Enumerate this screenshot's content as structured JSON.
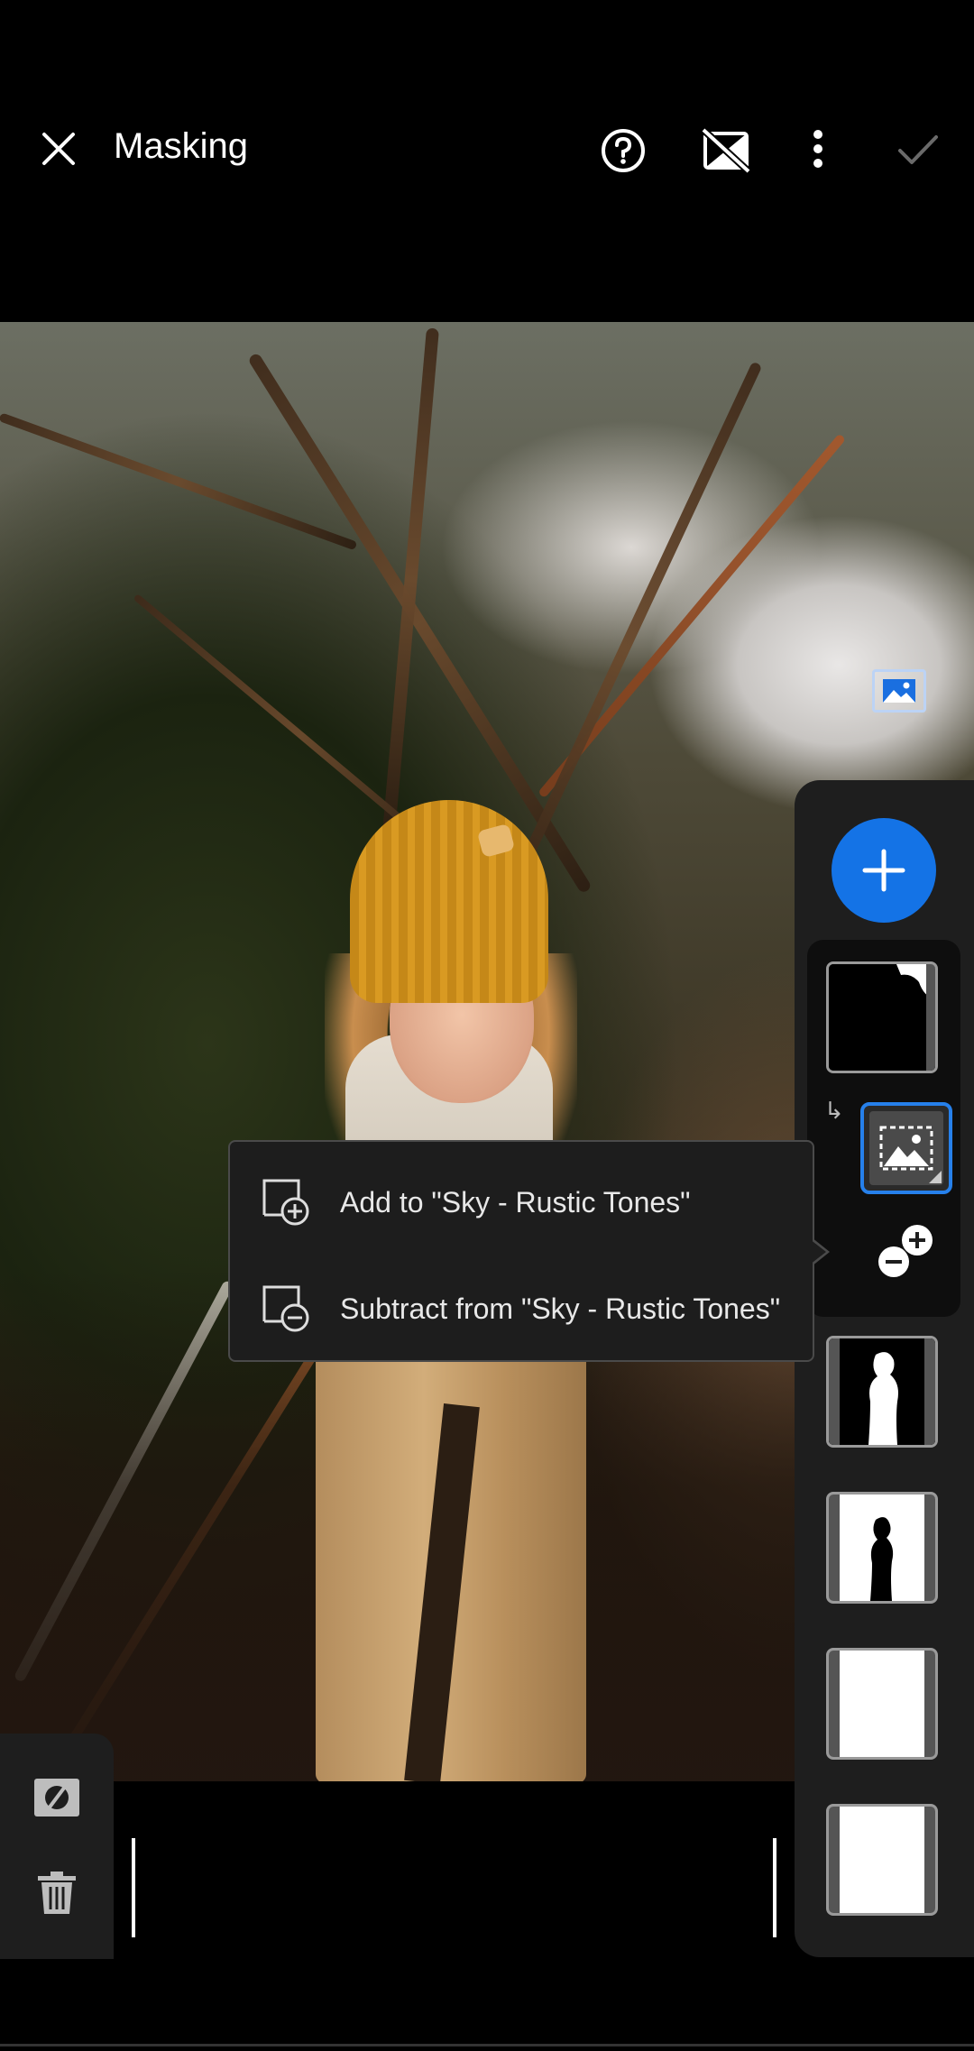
{
  "header": {
    "title": "Masking",
    "icons": [
      "close-icon",
      "help-icon",
      "mask-overlay-off-icon",
      "more-vertical-icon",
      "confirm-check-icon"
    ]
  },
  "popup_menu": {
    "items": [
      {
        "label": "Add to \"Sky - Rustic Tones\"",
        "icon": "add-mask-icon"
      },
      {
        "label": "Subtract from \"Sky - Rustic Tones\"",
        "icon": "subtract-mask-icon"
      }
    ]
  },
  "masks_panel": {
    "add_button_icon": "plus-icon",
    "masks": [
      {
        "name": "Sky - Rustic Tones",
        "thumbnail": "sky-mask-thumbnail"
      },
      {
        "name": "",
        "thumbnail": "subject-mask-thumbnail"
      },
      {
        "name": "",
        "thumbnail": "subject-inverse-mask-thumbnail"
      },
      {
        "name": "",
        "thumbnail": "white-mask-thumbnail"
      },
      {
        "name": "",
        "thumbnail": "white-mask-thumbnail"
      }
    ]
  },
  "colors": {
    "accent": "#1473e6",
    "selection": "#2680eb",
    "panel": "#1e1e1e",
    "background": "#000000"
  }
}
